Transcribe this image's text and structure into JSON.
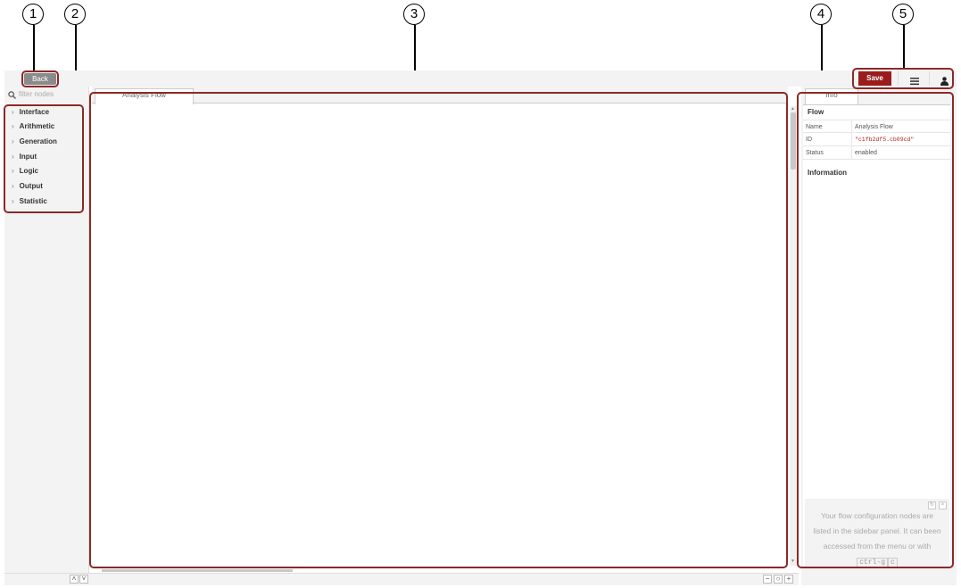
{
  "header": {
    "back_label": "Back",
    "save_label": "Save",
    "menu_icon": "hamburger-menu-icon",
    "user_icon": "user-icon"
  },
  "palette": {
    "filter_placeholder": "filter nodes",
    "categories": [
      "Interface",
      "Arithmetic",
      "Generation",
      "Input",
      "Logic",
      "Output",
      "Statistic"
    ]
  },
  "workspace": {
    "tabs": [
      "Analysis Flow"
    ]
  },
  "sidebar": {
    "tab_label": "Info",
    "section_flow": "Flow",
    "info_rows": [
      {
        "key": "Name",
        "value": "Analysis Flow"
      },
      {
        "key": "ID",
        "value": "\"c1fb2df5.cb09cd\""
      },
      {
        "key": "Status",
        "value": "enabled"
      }
    ],
    "section_information": "Information",
    "tip": {
      "text": "Your flow configuration nodes are listed in the sidebar panel. It can been accessed from the menu or with",
      "key1": "ctrl-g",
      "key2": "c"
    }
  },
  "callouts": [
    "1",
    "2",
    "3",
    "4",
    "5"
  ],
  "colors": {
    "accent": "#9b1c1c",
    "frame": "#8b2a28",
    "id_value": "#b02020"
  }
}
